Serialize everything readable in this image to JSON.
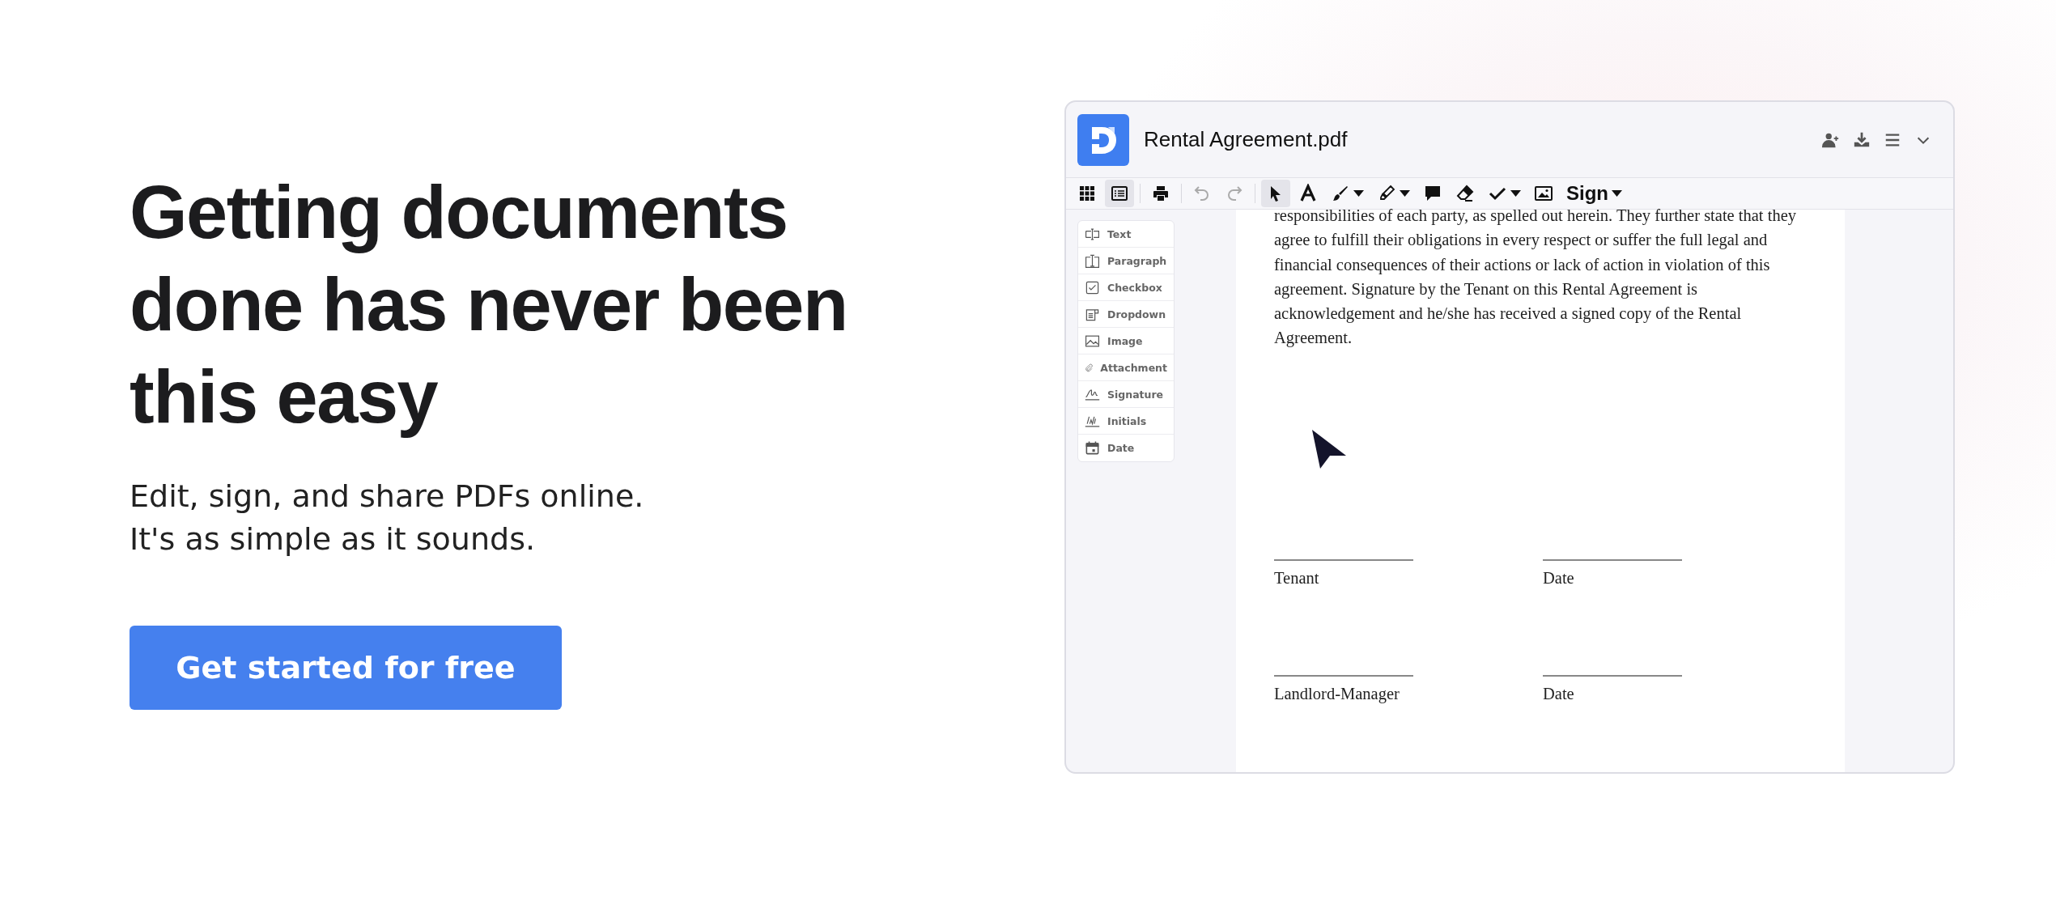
{
  "hero": {
    "heading": "Getting documents done has never been this easy",
    "subtitle_lines": [
      "Edit, sign, and share PDFs online.",
      "It's as simple as it sounds."
    ],
    "cta": "Get started for free"
  },
  "app": {
    "title": "Rental Agreement.pdf",
    "header_actions": [
      {
        "kind": "add-user"
      },
      {
        "kind": "download"
      },
      {
        "kind": "menu"
      },
      {
        "kind": "chevron"
      }
    ],
    "toolbar": [
      {
        "kind": "grid",
        "selected": false,
        "disabled": false
      },
      {
        "kind": "list",
        "selected": true,
        "disabled": false
      },
      {
        "kind": "print",
        "selected": false,
        "disabled": false
      },
      {
        "kind": "undo",
        "selected": false,
        "disabled": true
      },
      {
        "kind": "redo",
        "selected": false,
        "disabled": true
      },
      {
        "kind": "pointer",
        "selected": true,
        "disabled": false
      },
      {
        "kind": "text",
        "selected": false,
        "disabled": false
      },
      {
        "kind": "pen",
        "selected": false,
        "disabled": false
      },
      {
        "kind": "highlighter",
        "selected": false,
        "disabled": false
      },
      {
        "kind": "comment",
        "selected": false,
        "disabled": false
      },
      {
        "kind": "eraser",
        "selected": false,
        "disabled": false
      },
      {
        "kind": "check",
        "selected": false,
        "disabled": false
      },
      {
        "kind": "image",
        "selected": false,
        "disabled": false
      },
      {
        "kind": "sign",
        "label": "Sign",
        "selected": false,
        "disabled": false
      }
    ],
    "fields": [
      {
        "kind": "text",
        "label": "Text"
      },
      {
        "kind": "paragraph",
        "label": "Paragraph"
      },
      {
        "kind": "checkbox",
        "label": "Checkbox"
      },
      {
        "kind": "dropdown",
        "label": "Dropdown"
      },
      {
        "kind": "image",
        "label": "Image"
      },
      {
        "kind": "attachment",
        "label": "Attachment"
      },
      {
        "kind": "signature",
        "label": "Signature"
      },
      {
        "kind": "initials",
        "label": "Initials"
      },
      {
        "kind": "date",
        "label": "Date"
      }
    ],
    "document": {
      "paragraph_lines": [
        "responsibilities of each party, as spelled out herein. They further state that they",
        "agree to fulfill their obligations in every respect or suffer the full legal and",
        "financial consequences of their actions or lack of action in violation of this",
        "agreement. Signature by the Tenant on this Rental Agreement is",
        "acknowledgement and he/she has received a signed copy of the Rental",
        "Agreement."
      ],
      "signature_rows": [
        [
          "Tenant",
          "Date"
        ],
        [
          "Landlord-Manager",
          "Date"
        ]
      ]
    }
  }
}
